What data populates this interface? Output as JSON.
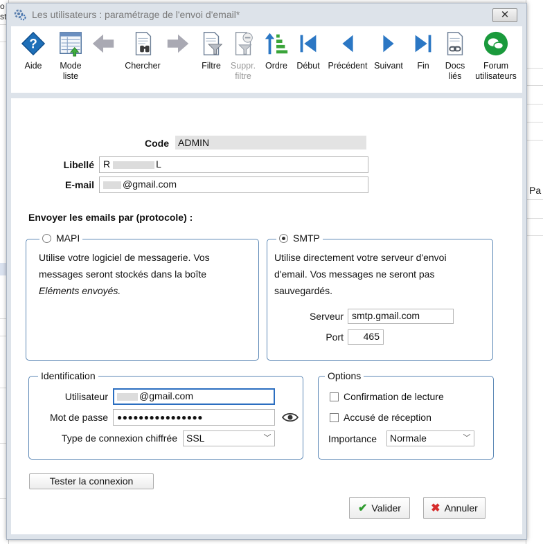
{
  "background": {
    "left_texts": [
      "o",
      "st"
    ],
    "right_text": "Pa"
  },
  "window": {
    "title": "Les utilisateurs : paramétrage de l'envoi d'email*",
    "close_glyph": "✕"
  },
  "toolbar": {
    "items": [
      {
        "label": "Aide",
        "icon": "help-icon"
      },
      {
        "label": "Mode\nliste",
        "icon": "list-mode-icon"
      },
      {
        "label": "",
        "icon": "arrow-left-icon"
      },
      {
        "label": "Chercher",
        "icon": "search-binoculars-icon"
      },
      {
        "label": "",
        "icon": "arrow-right-icon"
      },
      {
        "label": "Filtre",
        "icon": "filter-icon"
      },
      {
        "label": "Suppr.\nfiltre",
        "icon": "remove-filter-icon"
      },
      {
        "label": "Ordre",
        "icon": "sort-order-icon"
      },
      {
        "label": "Début",
        "icon": "first-record-icon"
      },
      {
        "label": "Précédent",
        "icon": "previous-record-icon"
      },
      {
        "label": "Suivant",
        "icon": "next-record-icon"
      },
      {
        "label": "Fin",
        "icon": "last-record-icon"
      },
      {
        "label": "Docs\nliés",
        "icon": "linked-docs-icon"
      },
      {
        "label": "Forum\nutilisateurs",
        "icon": "forum-icon"
      }
    ]
  },
  "form": {
    "code_label": "Code",
    "code_value": "ADMIN",
    "libelle_label": "Libellé",
    "libelle_value": "R",
    "libelle_value_tail": "L",
    "email_label": "E-mail",
    "email_value": "@gmail.com",
    "protocol_title": "Envoyer les emails par (protocole) :"
  },
  "mapi": {
    "legend": "MAPI",
    "selected": false,
    "description_line1": "Utilise votre logiciel de messagerie. Vos",
    "description_line2": "messages seront stockés dans la boîte",
    "description_italic": "Eléments envoyés."
  },
  "smtp": {
    "legend": "SMTP",
    "selected": true,
    "description_line1": "Utilise directement votre serveur d'envoi",
    "description_line2": "d'email. Vos messages ne seront pas",
    "description_line3": "sauvegardés.",
    "server_label": "Serveur",
    "server_value": "smtp.gmail.com",
    "port_label": "Port",
    "port_value": "465"
  },
  "identification": {
    "legend": "Identification",
    "user_label": "Utilisateur",
    "user_value": "@gmail.com",
    "password_label": "Mot de passe",
    "password_value": "●●●●●●●●●●●●●●●●",
    "encryption_label": "Type de connexion chiffrée",
    "encryption_value": "SSL"
  },
  "options": {
    "legend": "Options",
    "read_receipt_label": "Confirmation de lecture",
    "read_receipt_checked": false,
    "delivery_receipt_label": "Accusé de réception",
    "delivery_receipt_checked": false,
    "importance_label": "Importance",
    "importance_value": "Normale"
  },
  "buttons": {
    "test_connection": "Tester la connexion",
    "validate": "Valider",
    "cancel": "Annuler"
  },
  "colors": {
    "group_border": "#5b87b5",
    "focus_border": "#2b6ec0",
    "help_blue": "#1e6fb8",
    "forum_green": "#1a9a3c"
  }
}
